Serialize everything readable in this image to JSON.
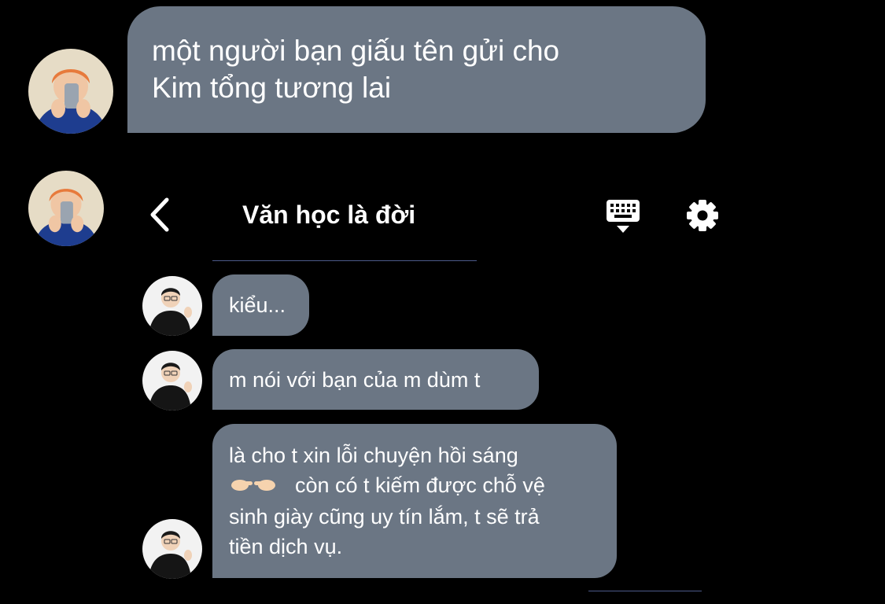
{
  "top_message": {
    "lines": [
      "một người bạn giấu tên gửi cho",
      "Kim tổng tương lai"
    ]
  },
  "embedded_chat": {
    "header": {
      "back_icon": "chevron-left-icon",
      "title": "Văn học là đời",
      "keyboard_icon": "keyboard-icon",
      "settings_icon": "gear-icon"
    },
    "messages": [
      {
        "text": "kiểu..."
      },
      {
        "text": "m nói với bạn của m dùm t"
      },
      {
        "lines": [
          "là cho t xin lỗi chuyện hồi sáng",
          "còn có t kiếm được chỗ vệ",
          "sinh giày cũng uy tín lắm, t sẽ trả",
          "tiền dịch vụ."
        ],
        "emoji": "👉👈"
      }
    ]
  },
  "colors": {
    "background": "#000000",
    "bubble": "#6b7684",
    "text": "#ffffff",
    "divider": "#4c5a8a"
  }
}
